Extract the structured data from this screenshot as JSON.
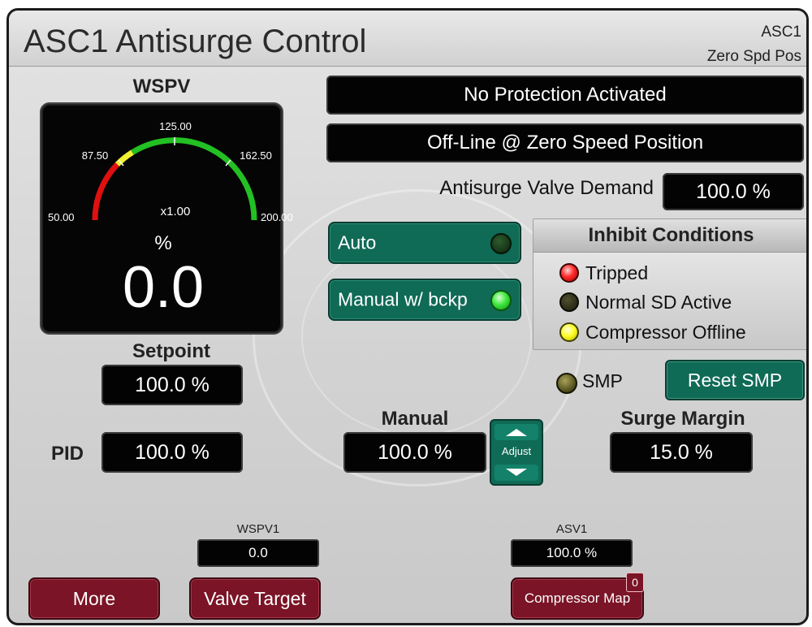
{
  "window": {
    "title": "ASC1 Antisurge Control",
    "id": "ASC1",
    "state_line": "Zero Spd Pos"
  },
  "gauge": {
    "label": "WSPV",
    "scale_min_label": "50.00",
    "scale_low_label": "87.50",
    "scale_mid_label": "125.00",
    "scale_high_label": "162.50",
    "scale_max_label": "200.00",
    "multiplier": "x1.00",
    "unit": "%",
    "value_text": "0.0",
    "colors": {
      "red": "#e01010",
      "yellow": "#f0f030",
      "green": "#23c023"
    }
  },
  "status": {
    "protection": "No Protection Activated",
    "mode": "Off-Line @ Zero Speed Position"
  },
  "valve_demand": {
    "label": "Antisurge Valve Demand",
    "value": "100.0 %"
  },
  "modes": {
    "auto": {
      "label": "Auto",
      "led": "off"
    },
    "manual_backup": {
      "label": "Manual w/ bckp",
      "led": "on"
    }
  },
  "inhibit": {
    "title": "Inhibit Conditions",
    "items": [
      {
        "label": "Tripped",
        "color": "#ff2a2a"
      },
      {
        "label": "Normal SD Active",
        "color": "#2a2a14"
      },
      {
        "label": "Compressor Offline",
        "color": "#ffff26"
      }
    ]
  },
  "smp": {
    "label": "SMP",
    "reset_label": "Reset SMP"
  },
  "setpoint": {
    "label": "Setpoint",
    "value": "100.0 %"
  },
  "pid": {
    "label": "PID",
    "value": "100.0 %"
  },
  "manual": {
    "label": "Manual",
    "value": "100.0 %",
    "adjust_label": "Adjust"
  },
  "surge_margin": {
    "label": "Surge Margin",
    "value": "15.0 %"
  },
  "wspv1": {
    "label": "WSPV1",
    "value": "0.0"
  },
  "asv1": {
    "label": "ASV1",
    "value": "100.0 %"
  },
  "footer": {
    "more": "More",
    "valve_target": "Valve Target",
    "compressor_map": "Compressor Map",
    "compressor_map_badge": "0"
  },
  "accent_colors": {
    "teal": "#0f6a56",
    "maroon": "#7a1426",
    "display_bg": "#030303"
  }
}
